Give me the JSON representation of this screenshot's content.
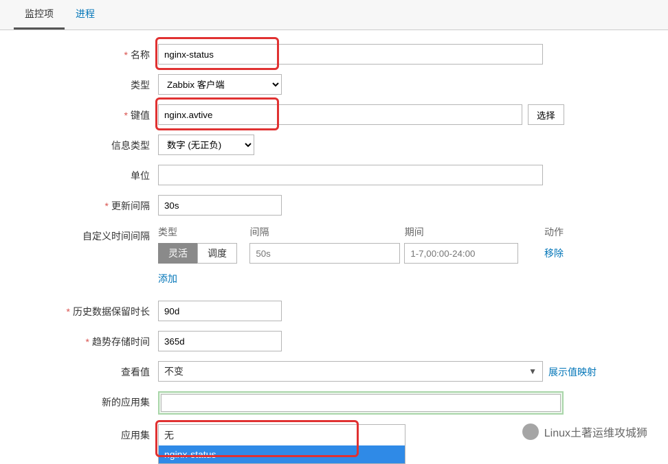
{
  "tabs": {
    "items": [
      "监控项",
      "进程"
    ],
    "active": 0
  },
  "form": {
    "name": {
      "label": "名称",
      "required": true,
      "value": "nginx-status"
    },
    "type": {
      "label": "类型",
      "required": false,
      "value": "Zabbix 客户端"
    },
    "key": {
      "label": "键值",
      "required": true,
      "value": "nginx.avtive",
      "select_btn": "选择"
    },
    "info_type": {
      "label": "信息类型",
      "required": false,
      "value": "数字 (无正负)"
    },
    "unit": {
      "label": "单位",
      "required": false,
      "value": ""
    },
    "interval": {
      "label": "更新间隔",
      "required": true,
      "value": "30s"
    },
    "custom_intv": {
      "label": "自定义时间间隔",
      "required": false,
      "cols": {
        "type": "类型",
        "interval": "间隔",
        "period": "期间",
        "action": "动作"
      },
      "row": {
        "toggle": {
          "flex": "灵活",
          "sched": "调度",
          "active": "flex"
        },
        "interval_ph": "50s",
        "period_ph": "1-7,00:00-24:00",
        "remove": "移除"
      },
      "add": "添加"
    },
    "history": {
      "label": "历史数据保留时长",
      "required": true,
      "value": "90d"
    },
    "trends": {
      "label": "趋势存储时间",
      "required": true,
      "value": "365d"
    },
    "view_value": {
      "label": "查看值",
      "required": false,
      "value": "不变",
      "map_link": "展示值映射"
    },
    "new_appset": {
      "label": "新的应用集",
      "required": false,
      "value": ""
    },
    "appset": {
      "label": "应用集",
      "required": false,
      "options": [
        "无",
        "nginx-status"
      ],
      "selected": 1
    }
  },
  "watermark": "Linux土著运维攻城狮"
}
